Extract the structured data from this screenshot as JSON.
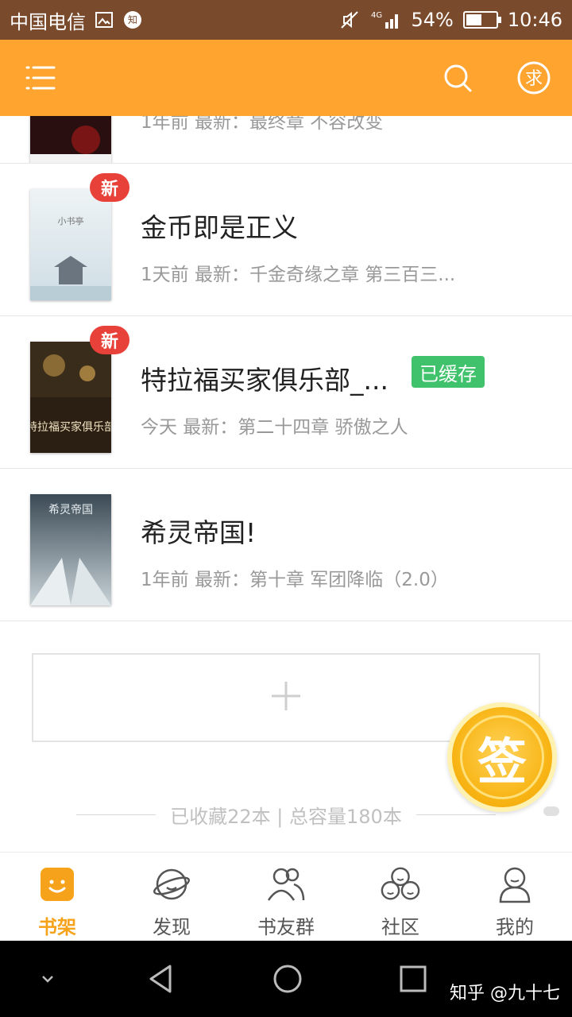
{
  "status_bar": {
    "carrier": "中国电信",
    "network": "4G",
    "battery_percent": "54%",
    "battery_level": 0.54,
    "time": "10:46",
    "icons": [
      "image-icon",
      "zhihu-icon",
      "mute-icon",
      "signal-icon",
      "battery-icon"
    ]
  },
  "header": {
    "icons": [
      "menu-icon",
      "search-icon",
      "request-icon"
    ]
  },
  "books": [
    {
      "title": "",
      "meta": "1年前 最新：最终章 不容改变",
      "badge": "",
      "cached": "",
      "partial": true,
      "cover_color": "#2a0f10"
    },
    {
      "title": "金币即是正义",
      "meta": "1天前 最新：千金奇缘之章 第三百三...",
      "badge": "新",
      "cached": "",
      "cover_text": "小书亭",
      "cover_color": "#dfe9ef"
    },
    {
      "title": "特拉福买家俱乐部_...",
      "meta": "今天 最新：第二十四章 骄傲之人",
      "badge": "新",
      "cached": "已缓存",
      "cover_text": "特拉福买家俱乐部",
      "cover_color": "#3a2c1a"
    },
    {
      "title": "希灵帝国!",
      "meta": "1年前 最新：第十章 军团降临（2.0）",
      "badge": "",
      "cached": "",
      "cover_text": "希灵帝国",
      "cover_color": "#3b4a55"
    }
  ],
  "add_box": {
    "icon": "plus-icon"
  },
  "summary": {
    "text": "已收藏22本 | 总容量180本"
  },
  "sign_in": {
    "label": "签"
  },
  "tabs": [
    {
      "label": "书架",
      "icon": "bookshelf-icon",
      "active": true
    },
    {
      "label": "发现",
      "icon": "discover-icon",
      "active": false
    },
    {
      "label": "书友群",
      "icon": "book-friends-icon",
      "active": false
    },
    {
      "label": "社区",
      "icon": "community-icon",
      "active": false
    },
    {
      "label": "我的",
      "icon": "profile-icon",
      "active": false
    }
  ],
  "nav": {
    "icons": [
      "down-icon",
      "back-icon",
      "home-icon",
      "recents-icon"
    ]
  },
  "watermark": "知乎 @九十七",
  "colors": {
    "accent": "#ffa42e",
    "badge_red": "#e8413a",
    "cached_green": "#3fc26b",
    "tab_active": "#f7a21b"
  }
}
